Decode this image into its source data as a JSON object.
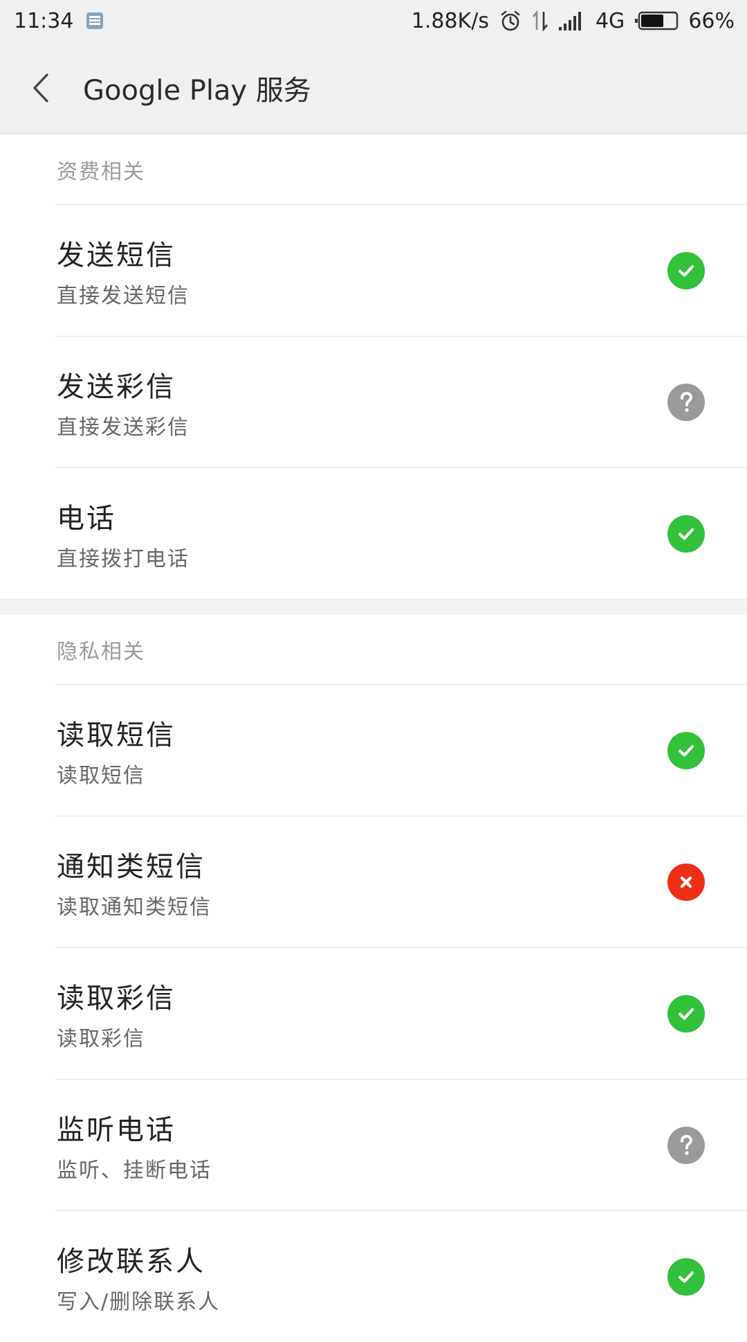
{
  "status_bar": {
    "time": "11:34",
    "net_speed": "1.88K/s",
    "network": "4G",
    "battery": "66%",
    "battery_level": 0.66
  },
  "header": {
    "title": "Google Play 服务"
  },
  "sections": [
    {
      "header": "资费相关",
      "items": [
        {
          "title": "发送短信",
          "desc": "直接发送短信",
          "status": "allowed"
        },
        {
          "title": "发送彩信",
          "desc": "直接发送彩信",
          "status": "ask"
        },
        {
          "title": "电话",
          "desc": "直接拨打电话",
          "status": "allowed"
        }
      ]
    },
    {
      "header": "隐私相关",
      "items": [
        {
          "title": "读取短信",
          "desc": "读取短信",
          "status": "allowed"
        },
        {
          "title": "通知类短信",
          "desc": "读取通知类短信",
          "status": "denied"
        },
        {
          "title": "读取彩信",
          "desc": "读取彩信",
          "status": "allowed"
        },
        {
          "title": "监听电话",
          "desc": "监听、挂断电话",
          "status": "ask"
        },
        {
          "title": "修改联系人",
          "desc": "写入/删除联系人",
          "status": "allowed"
        }
      ]
    }
  ],
  "colors": {
    "allowed": "#31c13a",
    "ask": "#9a9a9a",
    "denied": "#ec2f16"
  },
  "icons": {
    "allowed": "check-icon",
    "ask": "question-icon",
    "denied": "cross-icon"
  }
}
